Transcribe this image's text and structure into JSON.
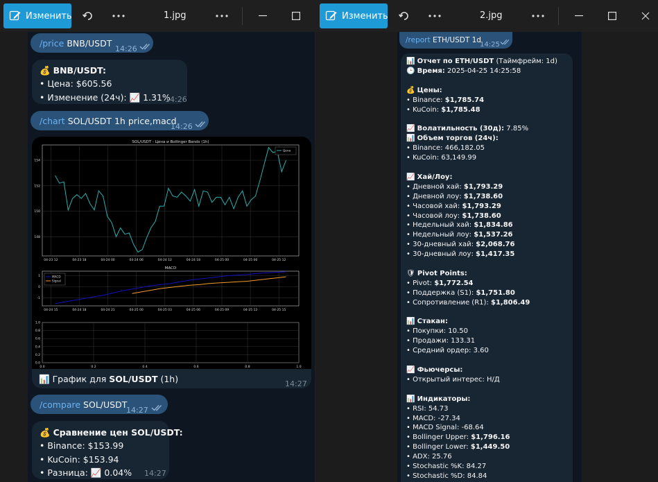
{
  "win1": {
    "edit_label": "Изменить",
    "title": "1.jpg",
    "messages": {
      "m1": {
        "cmd": "/price",
        "arg": "BNB/USDT",
        "time": "14:26"
      },
      "m2": {
        "icon": "💰",
        "title": "BNB/USDT:",
        "price": "• Цена: $605.56",
        "change_label": "• Изменение (24ч):",
        "change_icon": "📈",
        "change_value": "1.31%",
        "time": "14:26"
      },
      "m3": {
        "cmd": "/chart",
        "arg": "SOL/USDT 1h price,macd",
        "time": "14:26"
      },
      "m4": {
        "caption_icon": "📊",
        "caption_text": "График для",
        "caption_bold": "SOL/USDT",
        "caption_tail": "(1h)",
        "time": "14:27"
      },
      "m5": {
        "cmd": "/compare",
        "arg": "SOL/USDT",
        "time": "14:27"
      },
      "m6": {
        "icon": "💰",
        "title": "Сравнение цен SOL/USDT:",
        "binance": "• Binance: $153.99",
        "kucoin": "• KuCoin: $153.94",
        "diff_label": "• Разница:",
        "diff_icon": "📈",
        "diff_value": "0.04%",
        "time": "14:27"
      }
    }
  },
  "chart_data": [
    {
      "type": "line",
      "title": "SOL/USDT - Цена и Bollinger Bands (1h)",
      "legend": [
        "Цена"
      ],
      "legend_position": "top-right",
      "x_ticks": [
        "04-23 12",
        "04-23 18",
        "04-24 00",
        "04-24 06",
        "04-24 12",
        "04-24 18",
        "04-25 00",
        "04-25 06",
        "04-25 12"
      ],
      "y_ticks": [
        "148",
        "150",
        "152",
        "154"
      ],
      "ylim": [
        146.5,
        155.2
      ],
      "grid": true,
      "series": [
        {
          "name": "Цена",
          "color": "#2ab0b0",
          "values": [
            152.8,
            152.2,
            152.3,
            150.1,
            151.0,
            151.3,
            151.0,
            151.4,
            150.6,
            150.1,
            151.6,
            151.2,
            149.6,
            149.1,
            148.0,
            148.7,
            148.2,
            148.3,
            147.4,
            146.8,
            147.0,
            147.9,
            148.7,
            149.2,
            150.4,
            150.4,
            151.8,
            151.2,
            151.1,
            151.5,
            151.2,
            150.8,
            151.7,
            150.4,
            151.6,
            151.5,
            150.7,
            151.1,
            151.1,
            150.5,
            151.1,
            150.2,
            151.1,
            151.6,
            150.4,
            150.9,
            151.2,
            152.4,
            153.7,
            155.0,
            154.6,
            154.7,
            153.1,
            154.0
          ]
        }
      ]
    },
    {
      "type": "line",
      "title": "MACD",
      "legend": [
        "MACD",
        "Signal"
      ],
      "legend_position": "top-left",
      "x_ticks": [
        "04-24 15",
        "04-24 18",
        "04-24 21",
        "04-25 00",
        "04-25 03",
        "04-25 06",
        "04-25 09",
        "04-25 12",
        "04-25 15"
      ],
      "y_ticks": [
        "1",
        "0",
        "-1"
      ],
      "ylim": [
        -1.7,
        1.4
      ],
      "grid": true,
      "series": [
        {
          "name": "MACD",
          "color": "#1010c0",
          "values": [
            -1.5,
            -1.35,
            -1.2,
            -1.05,
            -0.9,
            -0.75,
            -0.55,
            -0.35,
            -0.2,
            -0.05,
            0.1,
            0.2,
            0.3,
            0.45,
            0.6,
            0.7,
            0.8,
            0.9,
            1.0,
            1.05,
            1.1,
            1.2,
            1.25,
            1.3,
            1.35
          ]
        },
        {
          "name": "Signal",
          "color": "#f39c2a",
          "values": [
            null,
            null,
            null,
            null,
            null,
            null,
            null,
            null,
            -0.6,
            -0.45,
            -0.3,
            -0.15,
            -0.05,
            0.05,
            0.15,
            0.2,
            0.3,
            0.35,
            0.4,
            0.45,
            0.5,
            0.6,
            0.7,
            0.8,
            0.9
          ]
        }
      ]
    },
    {
      "type": "line",
      "title": "",
      "x_ticks": [
        "0.0",
        "0.2",
        "0.4",
        "0.6",
        "0.8",
        "1.0"
      ],
      "y_ticks": [
        "0.0",
        "0.2",
        "0.4",
        "0.6",
        "0.8",
        "1.0"
      ],
      "xlim": [
        0,
        1
      ],
      "ylim": [
        0,
        1
      ],
      "grid": true,
      "series": []
    }
  ],
  "win2": {
    "edit_label": "Изменить",
    "title": "2.jpg",
    "cmd": {
      "cmd": "/report",
      "arg": "ETH/USDT 1d",
      "time": "14:25"
    },
    "report": {
      "head1_icon": "📊",
      "head1": "Отчет по ETH/USDT",
      "head1_tail": "(Таймфрейм: 1d)",
      "head2_icon": "🕒",
      "head2": "Время:",
      "head2_tail": "2025-04-25 14:25:58",
      "prices_icon": "💰",
      "prices": "Цены:",
      "p_binance": "• Binance:",
      "p_binance_v": "$1,785.74",
      "p_kucoin": "• KuCoin:",
      "p_kucoin_v": "$1,785.48",
      "vol_icon": "📈",
      "vol": "Волатильность (30д):",
      "vol_v": "7.85%",
      "volume_icon": "📊",
      "volume": "Объем торгов (24ч):",
      "v_binance": "• Binance: 466,182.05",
      "v_kucoin": "• KuCoin: 63,149.99",
      "hl_icon": "📈",
      "hl": "Хай/Лоу:",
      "hl1": "• Дневной хай:",
      "hl1_v": "$1,793.29",
      "hl2": "• Дневной лоу:",
      "hl2_v": "$1,738.60",
      "hl3": "• Часовой хай:",
      "hl3_v": "$1,793.29",
      "hl4": "• Часовой лоу:",
      "hl4_v": "$1,738.60",
      "hl5": "• Недельный хай:",
      "hl5_v": "$1,834.86",
      "hl6": "• Недельный лоу:",
      "hl6_v": "$1,537.26",
      "hl7": "• 30-дневный хай:",
      "hl7_v": "$2,068.76",
      "hl8": "• 30-дневный лоу:",
      "hl8_v": "$1,417.35",
      "pivot_icon": "🛡",
      "pivot": "Pivot Points:",
      "pv1": "• Pivot:",
      "pv1_v": "$1,772.54",
      "pv2": "• Поддержка (S1):",
      "pv2_v": "$1,751.80",
      "pv3": "• Сопротивление (R1):",
      "pv3_v": "$1,806.49",
      "book_icon": "📊",
      "book": "Стакан:",
      "bk1": "• Покупки: 10.50",
      "bk2": "• Продажи: 133.31",
      "bk3": "• Средний ордер: 3.60",
      "fut_icon": "📈",
      "fut": "Фьючерсы:",
      "ft1": "• Открытый интерес: Н/Д",
      "ind_icon": "📊",
      "ind": "Индикаторы:",
      "in1": "• RSI: 54.73",
      "in2": "• MACD: -27.34",
      "in3": "• MACD Signal: -68.64",
      "in4": "• Bollinger Upper:",
      "in4_v": "$1,796.16",
      "in5": "• Bollinger Lower:",
      "in5_v": "$1,449.50",
      "in6": "• ADX: 25.76",
      "in7": "• Stochastic %K: 84.27",
      "in8": "• Stochastic %D: 84.84"
    }
  }
}
